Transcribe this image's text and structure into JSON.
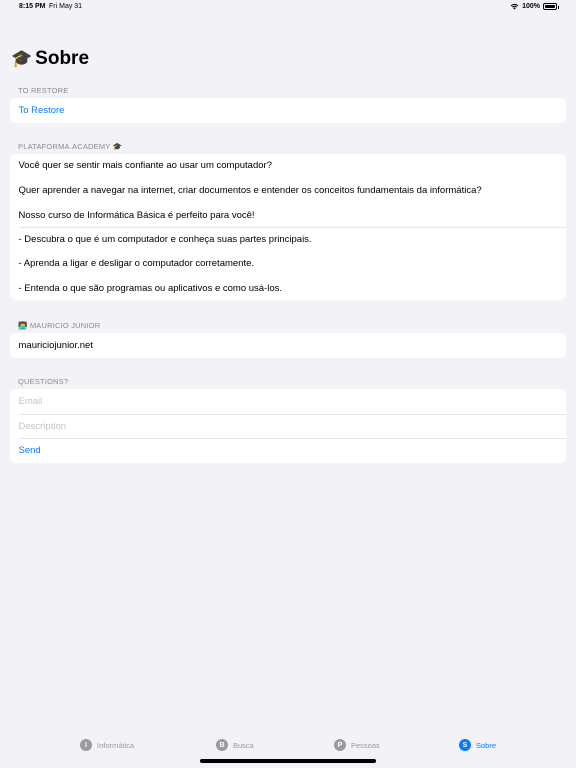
{
  "status": {
    "time": "8:15 PM",
    "date": "Fri May 31",
    "battery": "100%"
  },
  "page": {
    "title": "Sobre",
    "title_emoji": "🎓"
  },
  "sections": {
    "restore": {
      "header": "TO RESTORE",
      "button": "To Restore"
    },
    "academy": {
      "header": "PLATAFORMA.ACADEMY 🎓",
      "intro": [
        "Você quer se sentir mais confiante ao usar um computador?",
        "Quer aprender a navegar na internet, criar documentos e entender os conceitos fundamentais da informática?",
        "Nosso curso de Informática Básica é perfeito para você!"
      ],
      "bullets": [
        "- Descubra o que é um computador e conheça suas partes principais.",
        "- Aprenda a ligar e desligar o computador corretamente.",
        "- Entenda o que são programas ou aplicativos e como usá-los."
      ]
    },
    "author": {
      "header": "👨‍💻 MAURICIO JUNIOR",
      "link": "mauriciojunior.net"
    },
    "questions": {
      "header": "QUESTIONS?",
      "email_placeholder": "Email",
      "description_placeholder": "Description",
      "send": "Send"
    }
  },
  "tabs": [
    {
      "letter": "I",
      "label": "Informática",
      "active": false
    },
    {
      "letter": "B",
      "label": "Busca",
      "active": false
    },
    {
      "letter": "P",
      "label": "Pessoas",
      "active": false
    },
    {
      "letter": "S",
      "label": "Sobre",
      "active": true
    }
  ],
  "colors": {
    "accent": "#0a7aff",
    "background": "#f2f2f7",
    "inactive_tab": "#9a9aa0"
  }
}
